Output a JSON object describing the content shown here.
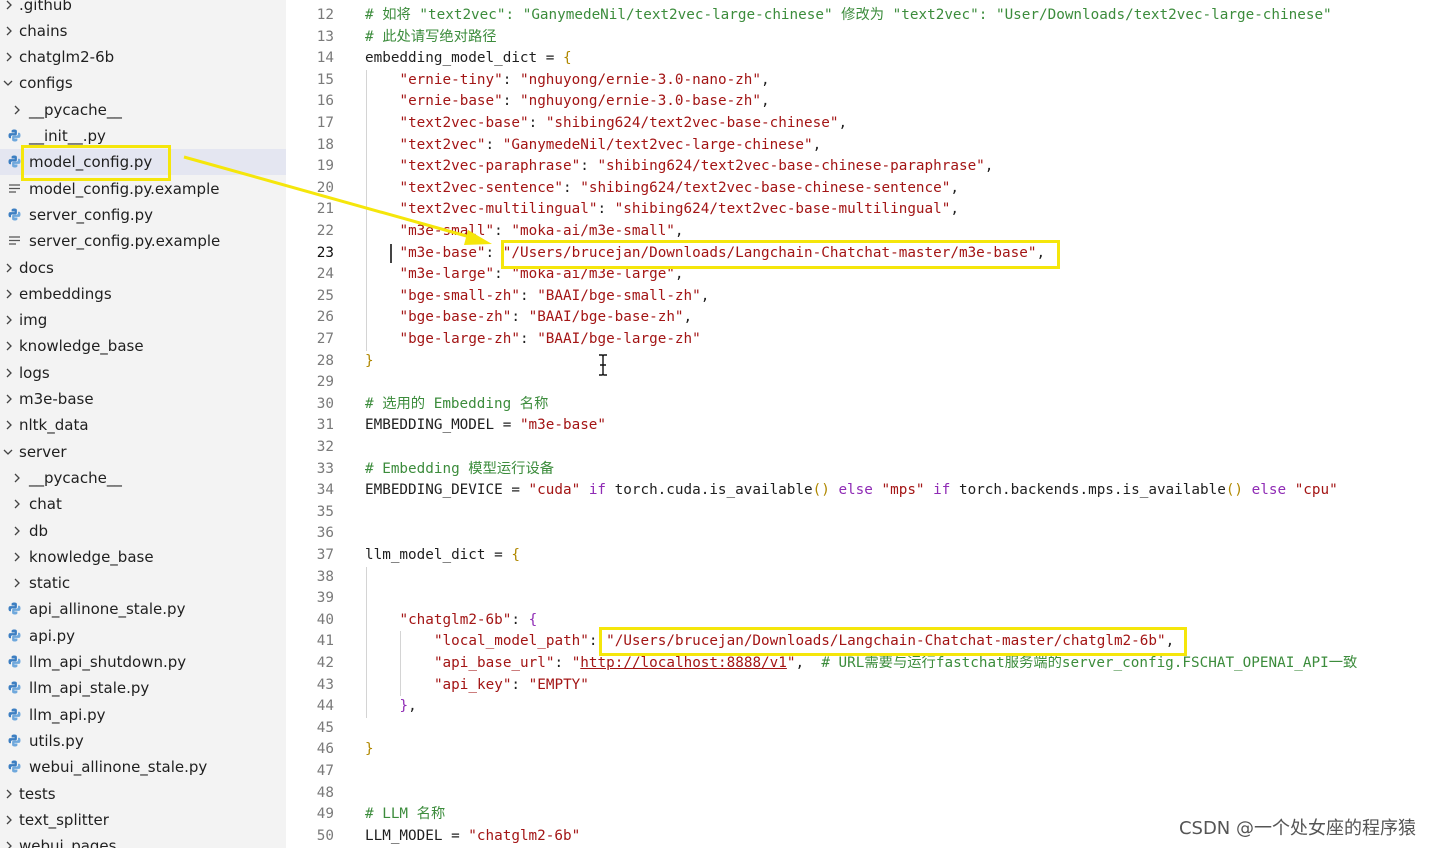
{
  "explorer": {
    "items": [
      {
        "label": ".github",
        "type": "folder",
        "expanded": false,
        "depth": 0
      },
      {
        "label": "chains",
        "type": "folder",
        "expanded": false,
        "depth": 0
      },
      {
        "label": "chatglm2-6b",
        "type": "folder",
        "expanded": false,
        "depth": 0
      },
      {
        "label": "configs",
        "type": "folder",
        "expanded": true,
        "depth": 0
      },
      {
        "label": "__pycache__",
        "type": "folder",
        "expanded": false,
        "depth": 1
      },
      {
        "label": "__init__.py",
        "type": "python",
        "depth": 1
      },
      {
        "label": "model_config.py",
        "type": "python",
        "depth": 1,
        "selected": true
      },
      {
        "label": "model_config.py.example",
        "type": "text",
        "depth": 1
      },
      {
        "label": "server_config.py",
        "type": "python",
        "depth": 1
      },
      {
        "label": "server_config.py.example",
        "type": "text",
        "depth": 1
      },
      {
        "label": "docs",
        "type": "folder",
        "expanded": false,
        "depth": 0
      },
      {
        "label": "embeddings",
        "type": "folder",
        "expanded": false,
        "depth": 0
      },
      {
        "label": "img",
        "type": "folder",
        "expanded": false,
        "depth": 0
      },
      {
        "label": "knowledge_base",
        "type": "folder",
        "expanded": false,
        "depth": 0
      },
      {
        "label": "logs",
        "type": "folder",
        "expanded": false,
        "depth": 0
      },
      {
        "label": "m3e-base",
        "type": "folder",
        "expanded": false,
        "depth": 0
      },
      {
        "label": "nltk_data",
        "type": "folder",
        "expanded": false,
        "depth": 0
      },
      {
        "label": "server",
        "type": "folder",
        "expanded": true,
        "depth": 0
      },
      {
        "label": "__pycache__",
        "type": "folder",
        "expanded": false,
        "depth": 1
      },
      {
        "label": "chat",
        "type": "folder",
        "expanded": false,
        "depth": 1
      },
      {
        "label": "db",
        "type": "folder",
        "expanded": false,
        "depth": 1
      },
      {
        "label": "knowledge_base",
        "type": "folder",
        "expanded": false,
        "depth": 1
      },
      {
        "label": "static",
        "type": "folder",
        "expanded": false,
        "depth": 1
      },
      {
        "label": "api_allinone_stale.py",
        "type": "python",
        "depth": 1
      },
      {
        "label": "api.py",
        "type": "python",
        "depth": 1
      },
      {
        "label": "llm_api_shutdown.py",
        "type": "python",
        "depth": 1
      },
      {
        "label": "llm_api_stale.py",
        "type": "python",
        "depth": 1
      },
      {
        "label": "llm_api.py",
        "type": "python",
        "depth": 1
      },
      {
        "label": "utils.py",
        "type": "python",
        "depth": 1
      },
      {
        "label": "webui_allinone_stale.py",
        "type": "python",
        "depth": 1
      },
      {
        "label": "tests",
        "type": "folder",
        "expanded": false,
        "depth": 0
      },
      {
        "label": "text_splitter",
        "type": "folder",
        "expanded": false,
        "depth": 0
      },
      {
        "label": "webui_pages",
        "type": "folder",
        "expanded": false,
        "depth": 0
      }
    ]
  },
  "editor": {
    "active_line": 23,
    "lines": [
      {
        "n": "12",
        "indent": 0,
        "tokens": [
          [
            "comment",
            "# 如将 \"text2vec\": \"GanymedeNil/text2vec-large-chinese\" 修改为 \"text2vec\": \"User/Downloads/text2vec-large-chinese\""
          ]
        ]
      },
      {
        "n": "13",
        "indent": 0,
        "tokens": [
          [
            "comment",
            "# 此处请写绝对路径"
          ]
        ]
      },
      {
        "n": "14",
        "indent": 0,
        "tokens": [
          [
            "plain",
            "embedding_model_dict = "
          ],
          [
            "brace",
            "{"
          ]
        ]
      },
      {
        "n": "15",
        "indent": 1,
        "tokens": [
          [
            "key",
            "\"ernie-tiny\""
          ],
          [
            "plain",
            ": "
          ],
          [
            "string",
            "\"nghuyong/ernie-3.0-nano-zh\""
          ],
          [
            "plain",
            ","
          ]
        ]
      },
      {
        "n": "16",
        "indent": 1,
        "tokens": [
          [
            "key",
            "\"ernie-base\""
          ],
          [
            "plain",
            ": "
          ],
          [
            "string",
            "\"nghuyong/ernie-3.0-base-zh\""
          ],
          [
            "plain",
            ","
          ]
        ]
      },
      {
        "n": "17",
        "indent": 1,
        "tokens": [
          [
            "key",
            "\"text2vec-base\""
          ],
          [
            "plain",
            ": "
          ],
          [
            "string",
            "\"shibing624/text2vec-base-chinese\""
          ],
          [
            "plain",
            ","
          ]
        ]
      },
      {
        "n": "18",
        "indent": 1,
        "tokens": [
          [
            "key",
            "\"text2vec\""
          ],
          [
            "plain",
            ": "
          ],
          [
            "string",
            "\"GanymedeNil/text2vec-large-chinese\""
          ],
          [
            "plain",
            ","
          ]
        ]
      },
      {
        "n": "19",
        "indent": 1,
        "tokens": [
          [
            "key",
            "\"text2vec-paraphrase\""
          ],
          [
            "plain",
            ": "
          ],
          [
            "string",
            "\"shibing624/text2vec-base-chinese-paraphrase\""
          ],
          [
            "plain",
            ","
          ]
        ]
      },
      {
        "n": "20",
        "indent": 1,
        "tokens": [
          [
            "key",
            "\"text2vec-sentence\""
          ],
          [
            "plain",
            ": "
          ],
          [
            "string",
            "\"shibing624/text2vec-base-chinese-sentence\""
          ],
          [
            "plain",
            ","
          ]
        ]
      },
      {
        "n": "21",
        "indent": 1,
        "tokens": [
          [
            "key",
            "\"text2vec-multilingual\""
          ],
          [
            "plain",
            ": "
          ],
          [
            "string",
            "\"shibing624/text2vec-base-multilingual\""
          ],
          [
            "plain",
            ","
          ]
        ]
      },
      {
        "n": "22",
        "indent": 1,
        "tokens": [
          [
            "key",
            "\"m3e-small\""
          ],
          [
            "plain",
            ": "
          ],
          [
            "string",
            "\"moka-ai/m3e-small\""
          ],
          [
            "plain",
            ","
          ]
        ]
      },
      {
        "n": "23",
        "indent": 1,
        "tokens": [
          [
            "key",
            "\"m3e-base\""
          ],
          [
            "plain",
            ": "
          ],
          [
            "string",
            "\"/Users/brucejan/Downloads/Langchain-Chatchat-master/m3e-base\""
          ],
          [
            "plain",
            ","
          ]
        ]
      },
      {
        "n": "24",
        "indent": 1,
        "tokens": [
          [
            "key",
            "\"m3e-large\""
          ],
          [
            "plain",
            ": "
          ],
          [
            "string",
            "\"moka-ai/m3e-large\""
          ],
          [
            "plain",
            ","
          ]
        ]
      },
      {
        "n": "25",
        "indent": 1,
        "tokens": [
          [
            "key",
            "\"bge-small-zh\""
          ],
          [
            "plain",
            ": "
          ],
          [
            "string",
            "\"BAAI/bge-small-zh\""
          ],
          [
            "plain",
            ","
          ]
        ]
      },
      {
        "n": "26",
        "indent": 1,
        "tokens": [
          [
            "key",
            "\"bge-base-zh\""
          ],
          [
            "plain",
            ": "
          ],
          [
            "string",
            "\"BAAI/bge-base-zh\""
          ],
          [
            "plain",
            ","
          ]
        ]
      },
      {
        "n": "27",
        "indent": 1,
        "tokens": [
          [
            "key",
            "\"bge-large-zh\""
          ],
          [
            "plain",
            ": "
          ],
          [
            "string",
            "\"BAAI/bge-large-zh\""
          ]
        ]
      },
      {
        "n": "28",
        "indent": 0,
        "tokens": [
          [
            "brace",
            "}"
          ]
        ]
      },
      {
        "n": "29",
        "indent": 0,
        "tokens": []
      },
      {
        "n": "30",
        "indent": 0,
        "tokens": [
          [
            "comment",
            "# 选用的 Embedding 名称"
          ]
        ]
      },
      {
        "n": "31",
        "indent": 0,
        "tokens": [
          [
            "plain",
            "EMBEDDING_MODEL = "
          ],
          [
            "string",
            "\"m3e-base\""
          ]
        ]
      },
      {
        "n": "32",
        "indent": 0,
        "tokens": []
      },
      {
        "n": "33",
        "indent": 0,
        "tokens": [
          [
            "comment",
            "# Embedding 模型运行设备"
          ]
        ]
      },
      {
        "n": "34",
        "indent": 0,
        "tokens": [
          [
            "plain",
            "EMBEDDING_DEVICE = "
          ],
          [
            "string",
            "\"cuda\""
          ],
          [
            "plain",
            " "
          ],
          [
            "kw",
            "if"
          ],
          [
            "plain",
            " torch.cuda.is_available"
          ],
          [
            "paren",
            "()"
          ],
          [
            "plain",
            " "
          ],
          [
            "kw",
            "else"
          ],
          [
            "plain",
            " "
          ],
          [
            "string",
            "\"mps\""
          ],
          [
            "plain",
            " "
          ],
          [
            "kw",
            "if"
          ],
          [
            "plain",
            " torch.backends.mps.is_available"
          ],
          [
            "paren",
            "()"
          ],
          [
            "plain",
            " "
          ],
          [
            "kw",
            "else"
          ],
          [
            "plain",
            " "
          ],
          [
            "string",
            "\"cpu\""
          ]
        ]
      },
      {
        "n": "35",
        "indent": 0,
        "tokens": []
      },
      {
        "n": "36",
        "indent": 0,
        "tokens": []
      },
      {
        "n": "37",
        "indent": 0,
        "tokens": [
          [
            "plain",
            "llm_model_dict = "
          ],
          [
            "brace",
            "{"
          ]
        ]
      },
      {
        "n": "38",
        "indent": 0,
        "tokens": []
      },
      {
        "n": "39",
        "indent": 0,
        "tokens": []
      },
      {
        "n": "40",
        "indent": 1,
        "tokens": [
          [
            "key",
            "\"chatglm2-6b\""
          ],
          [
            "plain",
            ": "
          ],
          [
            "kw",
            "{"
          ]
        ]
      },
      {
        "n": "41",
        "indent": 2,
        "tokens": [
          [
            "key",
            "\"local_model_path\""
          ],
          [
            "plain",
            ": "
          ],
          [
            "string",
            "\"/Users/brucejan/Downloads/Langchain-Chatchat-master/chatglm2-6b\""
          ],
          [
            "plain",
            ","
          ]
        ]
      },
      {
        "n": "42",
        "indent": 2,
        "tokens": [
          [
            "key",
            "\"api_base_url\""
          ],
          [
            "plain",
            ": "
          ],
          [
            "string",
            "\""
          ],
          [
            "link",
            "http://localhost:8888/v1"
          ],
          [
            "string",
            "\""
          ],
          [
            "plain",
            ",  "
          ],
          [
            "comment",
            "# URL需要与运行fastchat服务端的server_config.FSCHAT_OPENAI_API一致"
          ]
        ]
      },
      {
        "n": "43",
        "indent": 2,
        "tokens": [
          [
            "key",
            "\"api_key\""
          ],
          [
            "plain",
            ": "
          ],
          [
            "string",
            "\"EMPTY\""
          ]
        ]
      },
      {
        "n": "44",
        "indent": 1,
        "tokens": [
          [
            "kw",
            "}"
          ],
          [
            "plain",
            ","
          ]
        ]
      },
      {
        "n": "45",
        "indent": 0,
        "tokens": []
      },
      {
        "n": "46",
        "indent": 0,
        "tokens": [
          [
            "brace",
            "}"
          ]
        ]
      },
      {
        "n": "47",
        "indent": 0,
        "tokens": []
      },
      {
        "n": "48",
        "indent": 0,
        "tokens": []
      },
      {
        "n": "49",
        "indent": 0,
        "tokens": [
          [
            "comment",
            "# LLM 名称"
          ]
        ]
      },
      {
        "n": "50",
        "indent": 0,
        "tokens": [
          [
            "plain",
            "LLM_MODEL = "
          ],
          [
            "string",
            "\"chatglm2-6b\""
          ]
        ]
      }
    ]
  },
  "colors": {
    "annotation_yellow": "#f5e60b",
    "python_icon": "#3d7fc2"
  },
  "watermark": "CSDN @一个处女座的程序猿"
}
